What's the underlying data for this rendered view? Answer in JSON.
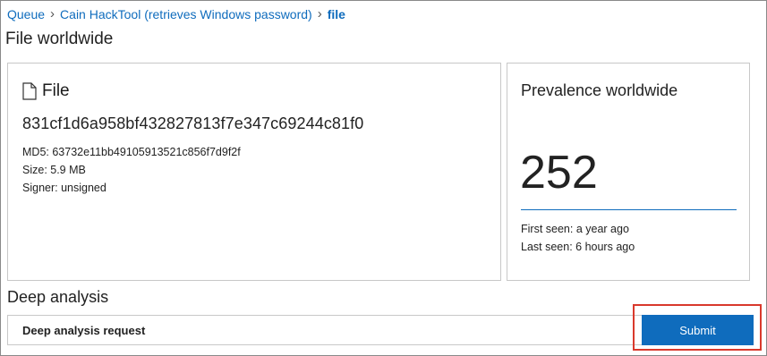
{
  "breadcrumb": {
    "items": [
      "Queue",
      "Cain HackTool (retrieves Windows password)"
    ],
    "current": "file"
  },
  "page_title": "File worldwide",
  "file_card": {
    "icon": "file-icon",
    "heading": "File",
    "hash": "831cf1d6a958bf432827813f7e347c69244c81f0",
    "md5": "MD5: 63732e11bb49105913521c856f7d9f2f",
    "size": "Size: 5.9 MB",
    "signer": "Signer: unsigned"
  },
  "prevalence_card": {
    "title": "Prevalence worldwide",
    "count": "252",
    "first_seen": "First seen: a year ago",
    "last_seen": "Last seen: 6 hours ago"
  },
  "deep_analysis": {
    "title": "Deep analysis",
    "request_label": "Deep analysis request",
    "submit_label": "Submit"
  },
  "colors": {
    "accent": "#0f6cbd",
    "highlight": "#d9392c"
  }
}
